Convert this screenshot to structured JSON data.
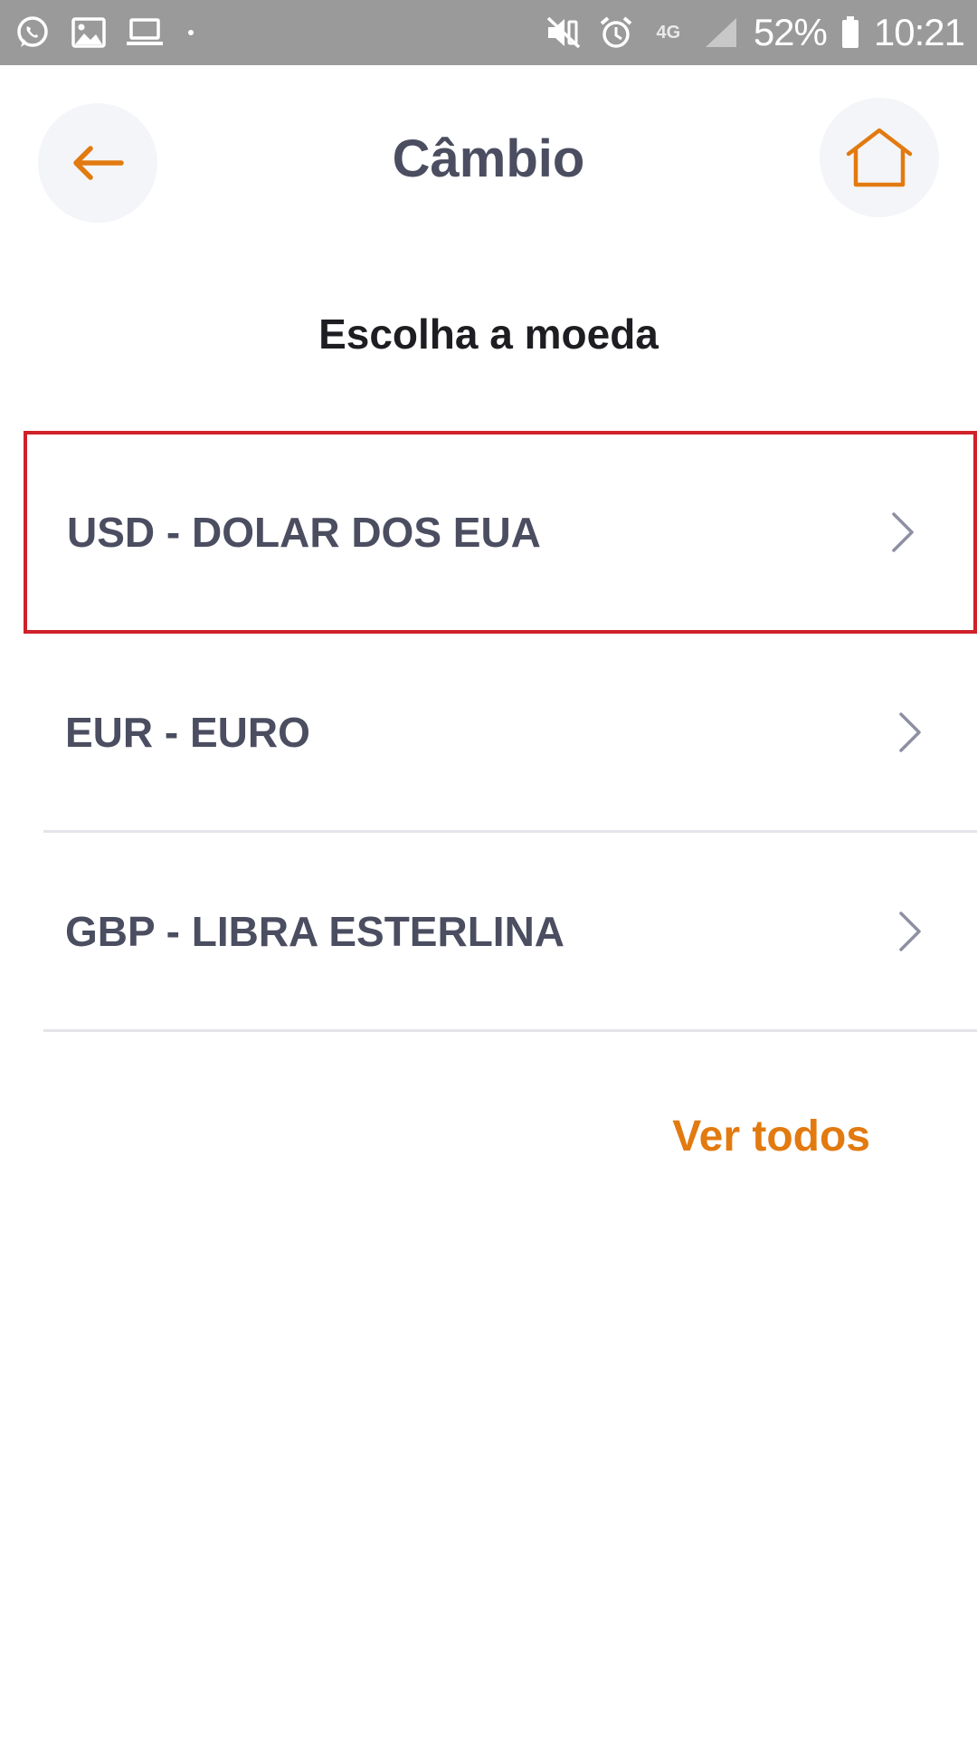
{
  "status_bar": {
    "battery": "52%",
    "time": "10:21",
    "network": "4G",
    "icons": [
      "whatsapp-icon",
      "gallery-icon",
      "laptop-icon",
      "mute-vibrate-icon",
      "alarm-icon",
      "signal-icon",
      "battery-icon"
    ]
  },
  "header": {
    "title": "Câmbio",
    "back_icon": "arrow-left-icon",
    "home_icon": "home-icon",
    "accent_color": "#e27a10"
  },
  "subtitle": "Escolha a moeda",
  "currencies": [
    {
      "label": "USD - DOLAR DOS EUA",
      "selected": true
    },
    {
      "label": "EUR - EURO",
      "selected": false
    },
    {
      "label": "GBP - LIBRA ESTERLINA",
      "selected": false
    }
  ],
  "see_all": "Ver todos",
  "colors": {
    "highlight_border": "#d0202a",
    "text_primary": "#4b4d60",
    "accent": "#e27a10"
  }
}
